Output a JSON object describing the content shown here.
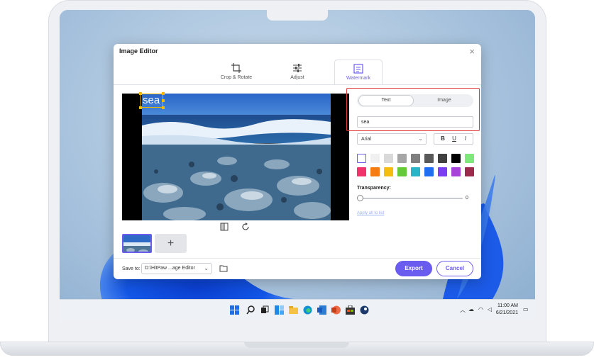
{
  "dialog": {
    "title": "Image Editor",
    "close_glyph": "×",
    "tabs": [
      {
        "label": "Crop & Rotate",
        "icon": "crop-icon"
      },
      {
        "label": "Adjust",
        "icon": "sliders-icon"
      },
      {
        "label": "Watermark",
        "icon": "watermark-icon",
        "active": true
      }
    ],
    "watermark_preview_text": "sea",
    "thumbnail_add_glyph": "+",
    "save_to": {
      "label": "Save to:",
      "path": "D:\\HitPaw ...age Editor",
      "chevron": "⌵"
    },
    "export_label": "Export",
    "cancel_label": "Cancel"
  },
  "watermark_panel": {
    "segment": {
      "text_label": "Text",
      "image_label": "Image",
      "selected": "Text"
    },
    "text_value": "sea",
    "font": {
      "value": "Arial"
    },
    "format_buttons": {
      "bold": "B",
      "underline": "U",
      "italic": "I"
    },
    "colors": [
      "#ffffff",
      "#f0f0f0",
      "#d9d9d9",
      "#a6a6a6",
      "#7f7f7f",
      "#595959",
      "#404040",
      "#000000",
      "#7ee87a",
      "#f0346b",
      "#f57c12",
      "#f5bd0f",
      "#66c93a",
      "#27b5c7",
      "#1f6ff0",
      "#7a3ff2",
      "#a743d9",
      "#9c2a4c"
    ],
    "selected_color": "#ffffff",
    "transparency": {
      "label": "Transparency:",
      "value": "0",
      "fraction": 0
    },
    "apply_all_label": "Apply all to list"
  },
  "taskbar": {
    "time": "11:00 AM",
    "date": "6/21/2021"
  },
  "theme": {
    "accent": "#6b5cf0",
    "highlight": "#e03b3b"
  }
}
